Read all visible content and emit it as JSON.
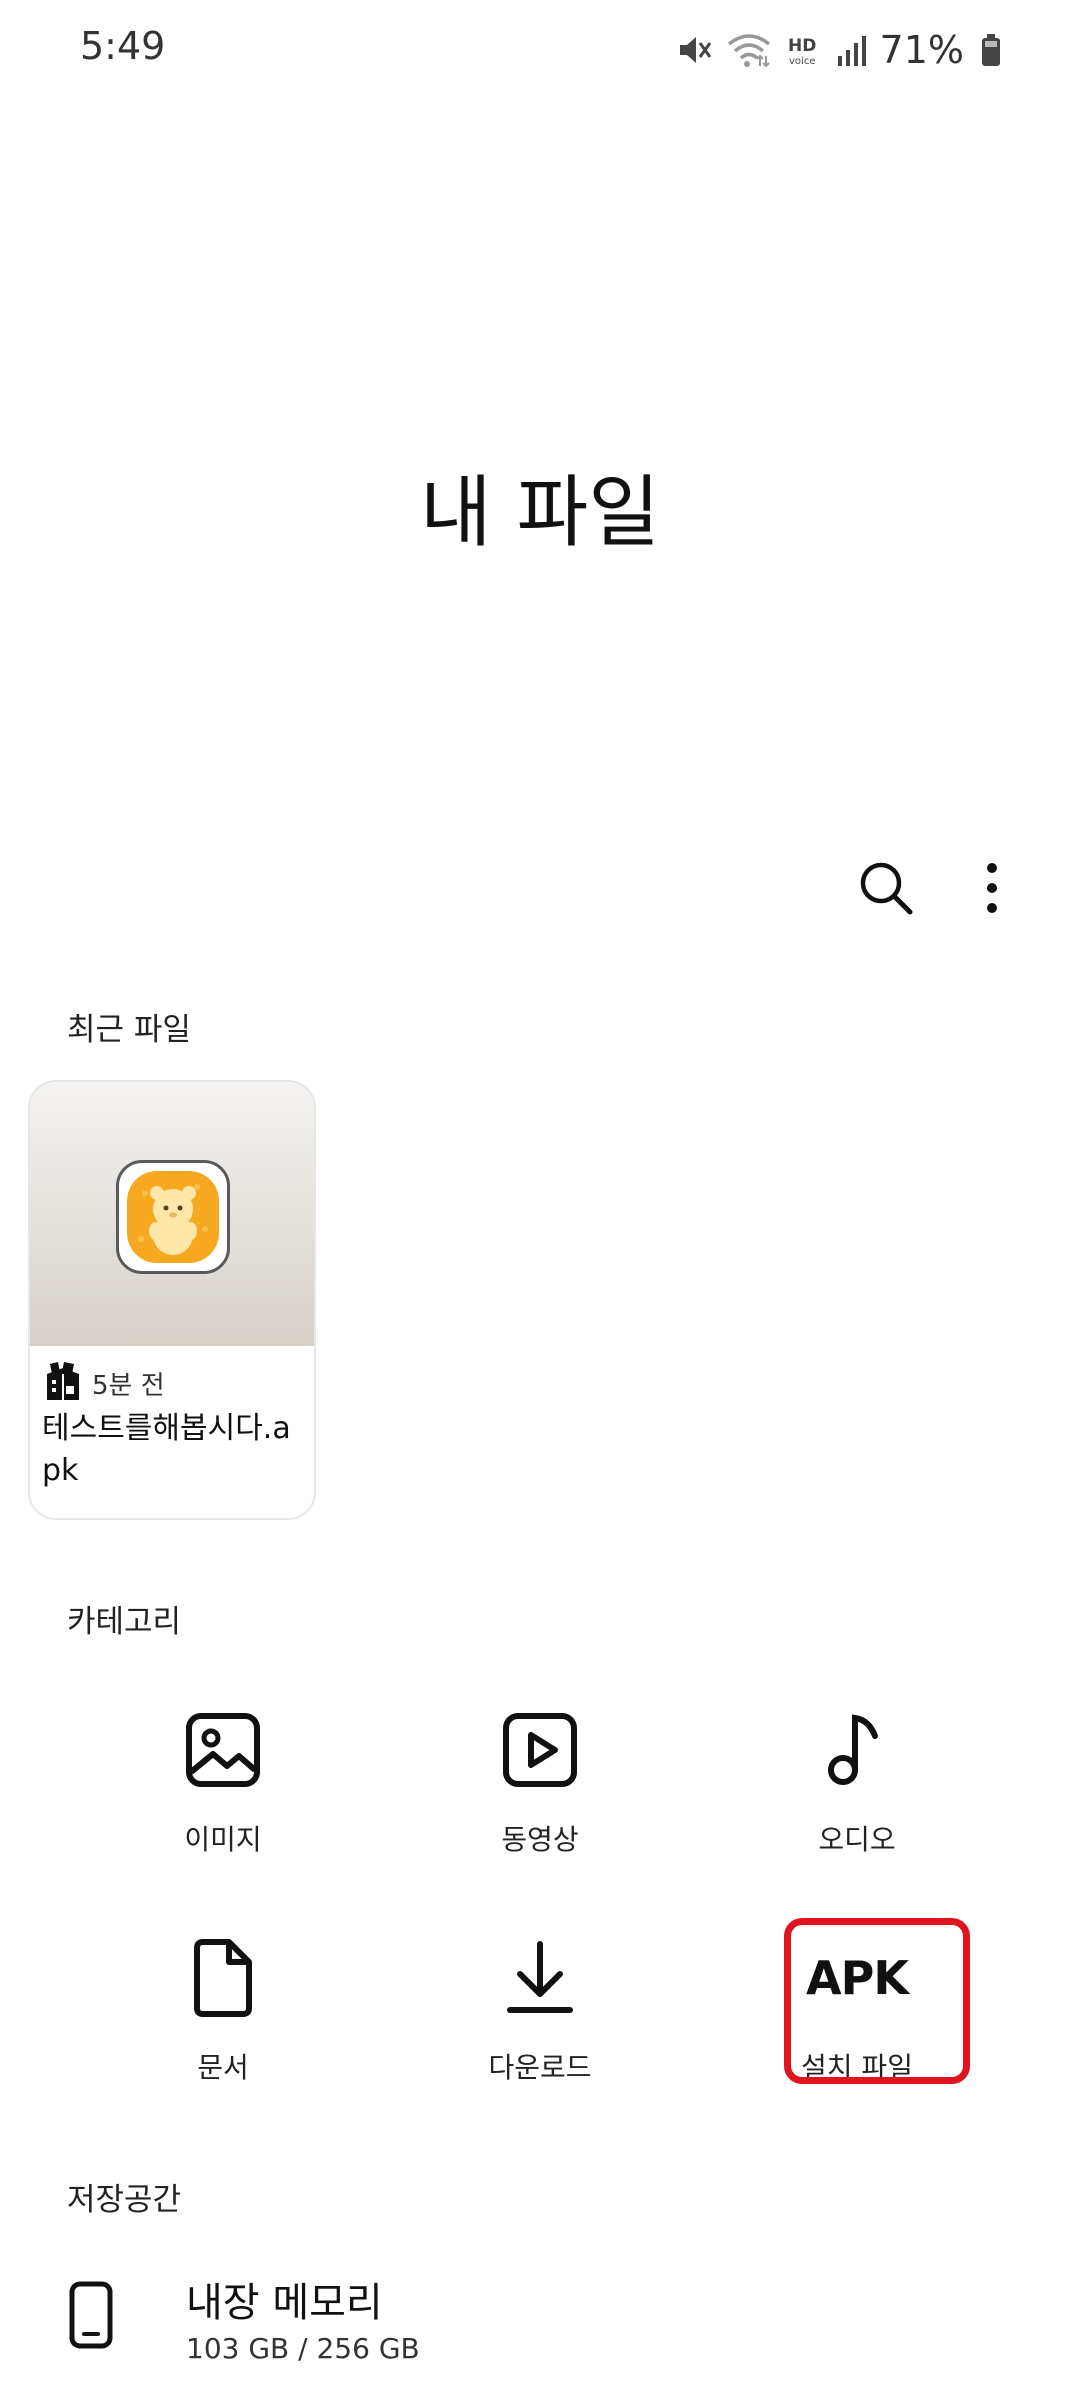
{
  "status_bar": {
    "time": "5:49",
    "battery": "71%",
    "icons": [
      "mute-icon",
      "wifi-icon",
      "hd-voice-icon",
      "signal-icon",
      "battery-icon"
    ]
  },
  "header": {
    "title": "내 파일",
    "actions": [
      "search-icon",
      "more-options-icon"
    ]
  },
  "recent": {
    "section_title": "최근 파일",
    "files": [
      {
        "time_ago": "5분 전",
        "name": "테스트를해봅시다.apk",
        "icon": "archive-box-icon"
      }
    ]
  },
  "categories": {
    "section_title": "카테고리",
    "items": [
      {
        "label": "이미지",
        "icon": "image-icon"
      },
      {
        "label": "동영상",
        "icon": "video-icon"
      },
      {
        "label": "오디오",
        "icon": "music-note-icon"
      },
      {
        "label": "문서",
        "icon": "document-icon"
      },
      {
        "label": "다운로드",
        "icon": "download-icon"
      },
      {
        "label": "설치 파일",
        "icon_text": "APK",
        "highlighted": true
      }
    ]
  },
  "storage": {
    "section_title": "저장공간",
    "items": [
      {
        "name": "내장 메모리",
        "size": "103 GB / 256 GB",
        "icon": "phone-icon"
      }
    ]
  },
  "colors": {
    "highlight": "#e0141e",
    "text": "#1a1a1a",
    "card_border": "#e6e6e6"
  }
}
